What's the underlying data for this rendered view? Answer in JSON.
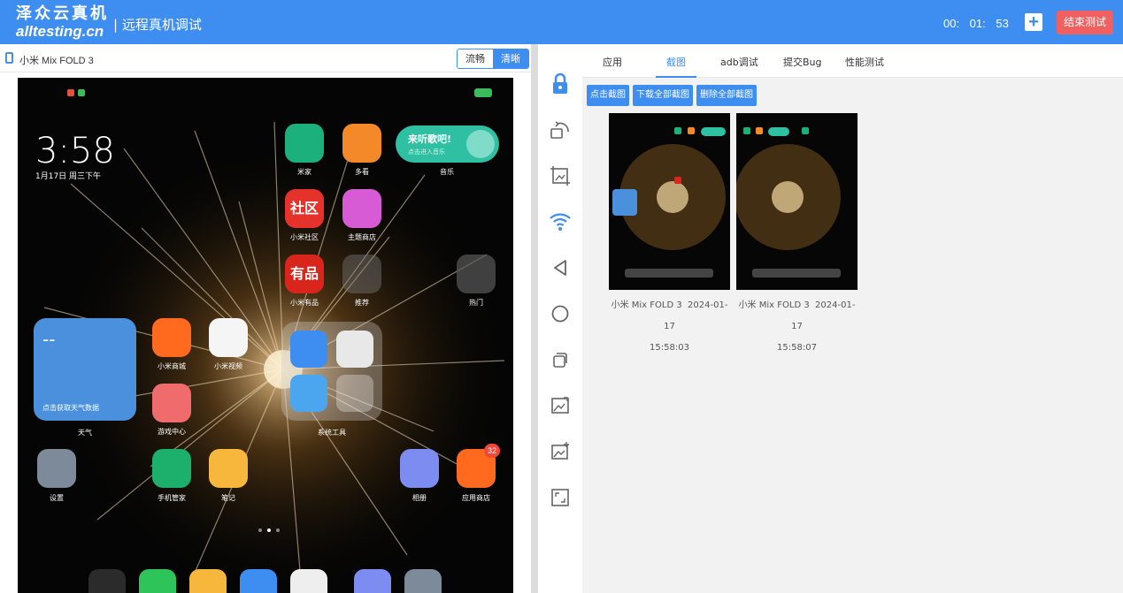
{
  "header": {
    "logo_cn": "泽众云真机",
    "logo_en": "alltesting.cn",
    "title": "| 远程真机调试",
    "timer": "00: 01: 53",
    "add_icon": "plus-icon",
    "end_button": "结束测试"
  },
  "device": {
    "name": "小米 Mix FOLD 3",
    "quality_options": [
      "流畅",
      "清晰"
    ],
    "quality_selected": "清晰"
  },
  "phone_screen": {
    "time": "3:58",
    "date": "1月17日 周三下午",
    "music_widget_title": "来听歌吧!",
    "music_widget_sub": "点击进入音乐",
    "weather_widget_text": "点击获取天气数据",
    "weather_temp": "--",
    "apps": [
      {
        "label": "米家"
      },
      {
        "label": "多看"
      },
      {
        "label": "音乐"
      },
      {
        "label": "小米社区"
      },
      {
        "label": "主题商店"
      },
      {
        "label": "小米有品"
      },
      {
        "label": "推荐"
      },
      {
        "label": "热门"
      },
      {
        "label": "天气"
      },
      {
        "label": "小米商城"
      },
      {
        "label": "小米视频"
      },
      {
        "label": "游戏中心"
      },
      {
        "label": "系统工具"
      },
      {
        "label": "设置"
      },
      {
        "label": "手机管家"
      },
      {
        "label": "笔记"
      },
      {
        "label": "相册"
      },
      {
        "label": "应用商店"
      }
    ],
    "appstore_badge": "32",
    "icon_text_community": "社区",
    "icon_text_youpin": "有品"
  },
  "toolbar": {
    "tools": [
      "lock-icon",
      "rotate-icon",
      "screenshot-crop-icon",
      "wifi-icon",
      "back-icon",
      "home-icon",
      "recents-icon",
      "image-upload-icon",
      "image-add-icon",
      "fullscreen-icon"
    ]
  },
  "tabs": [
    "应用",
    "截图",
    "adb调试",
    "提交Bug",
    "性能测试"
  ],
  "active_tab": "截图",
  "screenshot_actions": [
    "点击截图",
    "下载全部截图",
    "删除全部截图"
  ],
  "screenshots": [
    {
      "device": "小米 Mix FOLD 3",
      "date": "2024-01-17",
      "time": "15:58:03"
    },
    {
      "device": "小米 Mix FOLD 3",
      "date": "2024-01-17",
      "time": "15:58:07"
    }
  ],
  "colors": {
    "header_blue": "#3d8ef0",
    "end_red": "#f06060"
  }
}
